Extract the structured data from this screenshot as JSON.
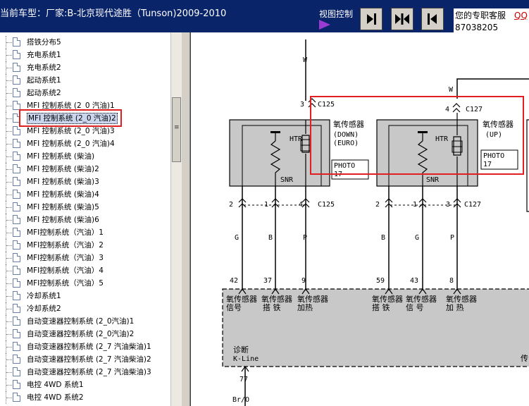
{
  "header": {
    "title": "当前车型：厂家:B-北京现代途胜（Tunson)2009-2010",
    "view_control_label": "视图控制",
    "buttons": [
      {
        "name": "view-right-button",
        "icon": "arrow-right-bar-icon"
      },
      {
        "name": "view-split-button",
        "icon": "arrow-split-icon"
      },
      {
        "name": "view-left-button",
        "icon": "arrow-left-bar-icon"
      }
    ],
    "service_label": "您的专职客服",
    "service_link": "QQ",
    "service_phone": "87038205"
  },
  "sidebar": {
    "items": [
      {
        "label": "搭铁分布5"
      },
      {
        "label": "充电系统1"
      },
      {
        "label": "充电系统2"
      },
      {
        "label": "起动系统1"
      },
      {
        "label": "起动系统2"
      },
      {
        "label": "MFI 控制系统 (2_0 汽油)1"
      },
      {
        "label": "MFI 控制系统 (2_0 汽油)2",
        "selected": true
      },
      {
        "label": "MFI 控制系统 (2_0 汽油)3"
      },
      {
        "label": "MFI 控制系统 (2_0 汽油)4"
      },
      {
        "label": "MFI 控制系统 (柴油)"
      },
      {
        "label": "MFI 控制系统 (柴油)2"
      },
      {
        "label": "MFI 控制系统 (柴油)3"
      },
      {
        "label": "MFI 控制系统 (柴油)4"
      },
      {
        "label": "MFI 控制系统 (柴油)5"
      },
      {
        "label": "MFI 控制系统 (柴油)6"
      },
      {
        "label": "MFI控制系统（汽油）1"
      },
      {
        "label": "MFI控制系统（汽油）2"
      },
      {
        "label": "MFI控制系统（汽油）3"
      },
      {
        "label": "MFI控制系统（汽油）4"
      },
      {
        "label": "MFI控制系统（汽油）5"
      },
      {
        "label": "冷却系统1"
      },
      {
        "label": "冷却系统2"
      },
      {
        "label": "自动变速器控制系统 (2_0汽油)1"
      },
      {
        "label": "自动变速器控制系统 (2_0汽油)2"
      },
      {
        "label": "自动变速器控制系统 (2_7 汽油柴油)1"
      },
      {
        "label": "自动变速器控制系统 (2_7 汽油柴油)2"
      },
      {
        "label": "自动变速器控制系统 (2_7 汽油柴油)3"
      },
      {
        "label": "电控 4WD 系统1"
      },
      {
        "label": "电控 4WD 系统2"
      }
    ]
  },
  "diagram": {
    "wire_top_left": "W",
    "wire_top_right": "W",
    "conn_c125_top": "C125",
    "conn_c127_top": "C127",
    "pin_c125_top": "3",
    "pin_c127_top": "4",
    "sensor_down_title": "氧传感器",
    "sensor_down_sub1": "(DOWN)",
    "sensor_down_sub2": "(EURO)",
    "sensor_up_title": "氧传感器",
    "sensor_up_sub": "(UP)",
    "htr": "HTR",
    "snr": "SNR",
    "photo": "PHOTO",
    "photo_num": "17",
    "bottom_pins_left": [
      "2",
      "1",
      "4"
    ],
    "bottom_pins_right": [
      "2",
      "1",
      "3"
    ],
    "conn_c125_bottom": "C125",
    "conn_c127_bottom": "C127",
    "wire_colors_left": [
      "G",
      "B",
      "P"
    ],
    "wire_colors_right": [
      "B",
      "G",
      "P"
    ],
    "ecm_pins": [
      "42",
      "37",
      "9",
      "59",
      "43",
      "8"
    ],
    "ecm_labels": [
      [
        "氧传感器",
        "信号"
      ],
      [
        "氧传感器",
        "搭  铁"
      ],
      [
        "氧传感器",
        "加热"
      ],
      [
        "氧传感器",
        "搭  铁"
      ],
      [
        "氧传感器",
        "信  号"
      ],
      [
        "氧传感器",
        "加  热"
      ]
    ],
    "diag_label_cn": "诊断",
    "diag_label_en": "K-Line",
    "diag_pin": "77",
    "diag_wire": "Br/O",
    "right_edge_cn": "传"
  }
}
